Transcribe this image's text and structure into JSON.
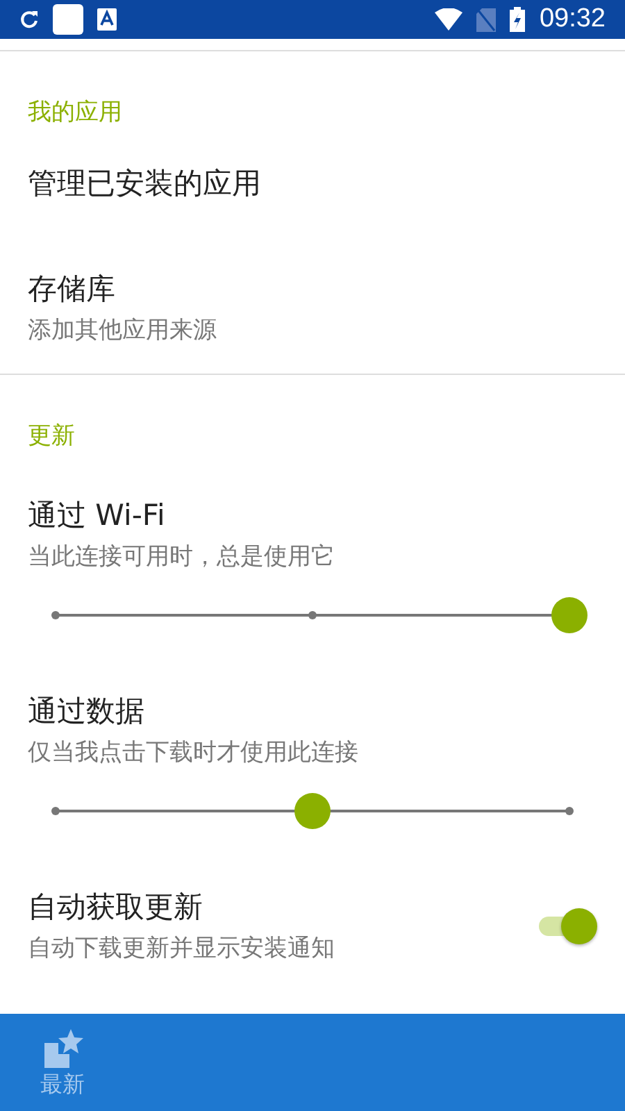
{
  "status_bar": {
    "time": "09:32"
  },
  "sections": [
    {
      "header": "我的应用",
      "items": [
        {
          "kind": "plain",
          "title": "管理已安装的应用"
        },
        {
          "kind": "plain",
          "title": "存储库",
          "summary": "添加其他应用来源"
        }
      ]
    },
    {
      "header": "更新",
      "items": [
        {
          "kind": "slider",
          "title": "通过 Wi-Fi",
          "summary": "当此连接可用时，总是使用它",
          "level": 1
        },
        {
          "kind": "slider",
          "title": "通过数据",
          "summary": "仅当我点击下载时才使用此连接",
          "level": 0.5
        },
        {
          "kind": "switch",
          "title": "自动获取更新",
          "summary": "自动下载更新并显示安装通知",
          "on": true
        }
      ]
    }
  ],
  "bottom_nav": [
    {
      "label": "最新",
      "selected": false
    }
  ]
}
